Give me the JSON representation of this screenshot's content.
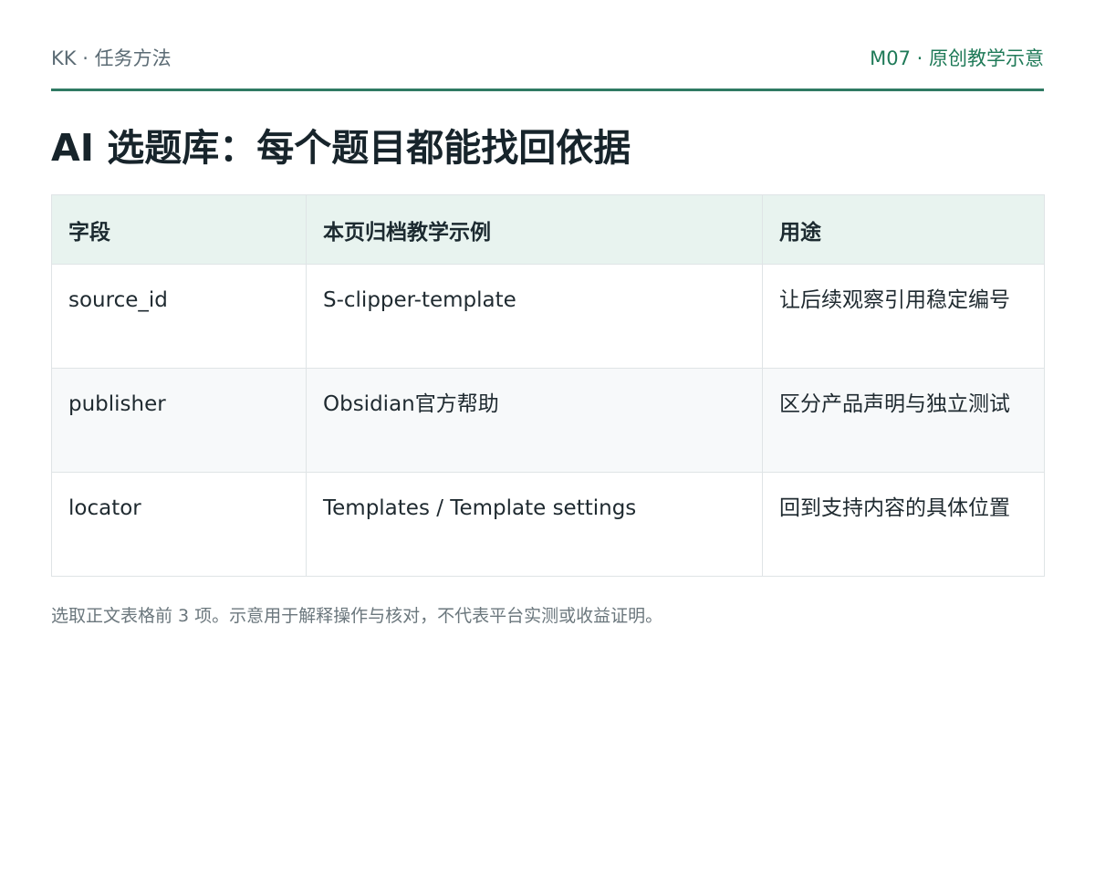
{
  "header": {
    "brand": "KK · 任务方法",
    "module": "M07 · 原创教学示意"
  },
  "title": "AI 选题库：每个题目都能找回依据",
  "table": {
    "headers": [
      "字段",
      "本页归档教学示例",
      "用途"
    ],
    "rows": [
      [
        "source_id",
        "S-clipper-template",
        "让后续观察引用稳定编号"
      ],
      [
        "publisher",
        "Obsidian官方帮助",
        "区分产品声明与独立测试"
      ],
      [
        "locator",
        "Templates / Template settings",
        "回到支持内容的具体位置"
      ]
    ]
  },
  "footnote": "选取正文表格前 3 项。示意用于解释操作与核对，不代表平台实测或收益证明。",
  "colors": {
    "accent": "#1f7a58",
    "rule": "#2f7a63",
    "header_bg": "#e8f3ef"
  }
}
